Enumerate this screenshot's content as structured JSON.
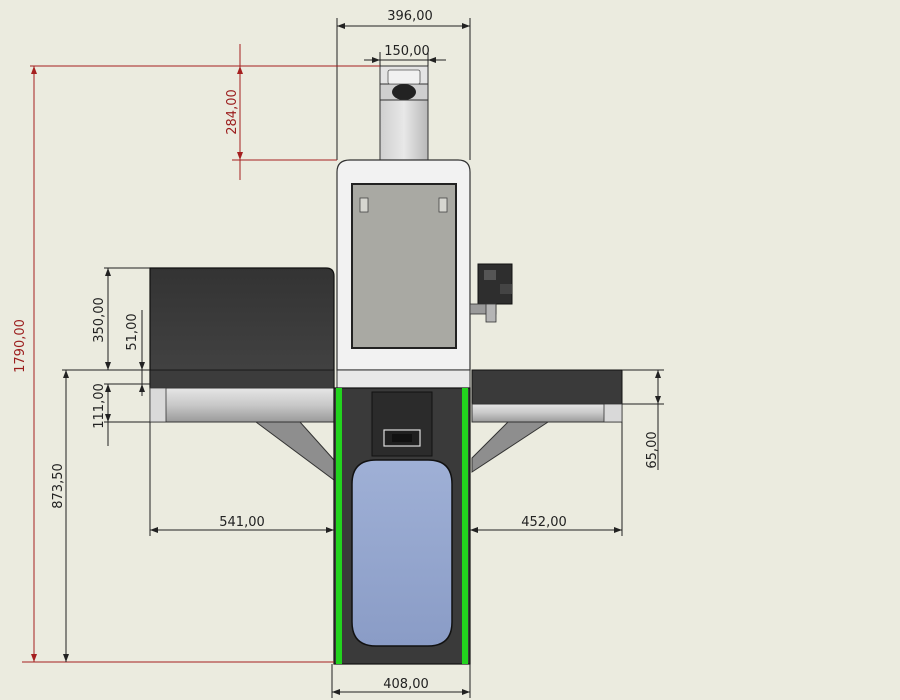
{
  "colors": {
    "background": "#ebebdf",
    "dimension_line": "#222222",
    "highlight_dimension": "#a51f1f",
    "housing_dark": "#3a3a3a",
    "screen_blue": "#8c9fc9",
    "edge_green": "#22d31e",
    "steel": "#bdbdbd"
  },
  "dimensions": {
    "top_width": "396,00",
    "neck_width": "150,00",
    "neck_height": "284,00",
    "total_height": "1790,00",
    "left_panel_height": "350,00",
    "left_panel_inset": "51,00",
    "shelf_thickness": "111,00",
    "shelf_height": "873,50",
    "left_reach": "541,00",
    "right_reach": "452,00",
    "right_shelf_thickness": "65,00",
    "base_width": "408,00"
  }
}
